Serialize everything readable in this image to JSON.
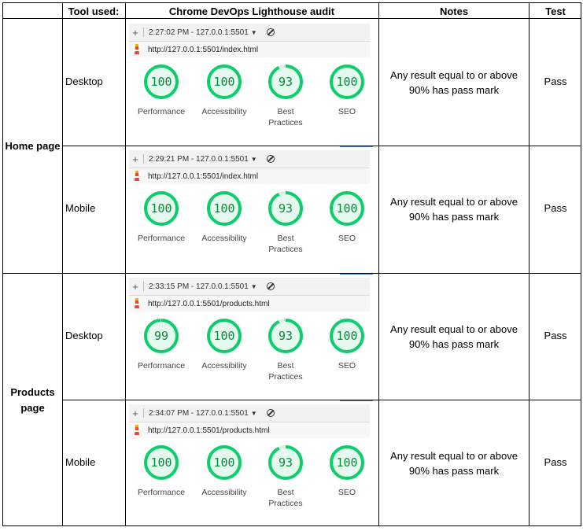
{
  "headers": {
    "tool_used": "Tool used:",
    "audit": "Chrome DevOps Lighthouse audit",
    "notes": "Notes",
    "test": "Test"
  },
  "groups": [
    {
      "label_lines": [
        "Home page"
      ],
      "rows": [
        {
          "device": "Desktop",
          "time": "2:27:02 PM - 127.0.0.1:5501",
          "url": "http://127.0.0.1:5501/index.html",
          "scores": [
            {
              "value": "100",
              "label_lines": [
                "Performance"
              ],
              "fraction": 1.0
            },
            {
              "value": "100",
              "label_lines": [
                "Accessibility"
              ],
              "fraction": 1.0
            },
            {
              "value": "93",
              "label_lines": [
                "Best",
                "Practices"
              ],
              "fraction": 0.93
            },
            {
              "value": "100",
              "label_lines": [
                "SEO"
              ],
              "fraction": 1.0
            }
          ],
          "note": "Any result equal to or above 90% has pass mark",
          "result": "Pass"
        },
        {
          "device": "Mobile",
          "time": "2:29:21 PM - 127.0.0.1:5501",
          "url": "http://127.0.0.1:5501/index.html",
          "scores": [
            {
              "value": "100",
              "label_lines": [
                "Performance"
              ],
              "fraction": 1.0
            },
            {
              "value": "100",
              "label_lines": [
                "Accessibility"
              ],
              "fraction": 1.0
            },
            {
              "value": "93",
              "label_lines": [
                "Best",
                "Practices"
              ],
              "fraction": 0.93
            },
            {
              "value": "100",
              "label_lines": [
                "SEO"
              ],
              "fraction": 1.0
            }
          ],
          "note": "Any result equal to or above 90% has pass mark",
          "result": "Pass"
        }
      ]
    },
    {
      "label_lines": [
        "Products",
        "page"
      ],
      "rows": [
        {
          "device": "Desktop",
          "time": "2:33:15 PM - 127.0.0.1:5501",
          "url": "http://127.0.0.1:5501/products.html",
          "scores": [
            {
              "value": "99",
              "label_lines": [
                "Performance"
              ],
              "fraction": 0.99
            },
            {
              "value": "100",
              "label_lines": [
                "Accessibility"
              ],
              "fraction": 1.0
            },
            {
              "value": "93",
              "label_lines": [
                "Best",
                "Practices"
              ],
              "fraction": 0.93
            },
            {
              "value": "100",
              "label_lines": [
                "SEO"
              ],
              "fraction": 1.0
            }
          ],
          "note": "Any result equal to or above 90% has pass mark",
          "result": "Pass"
        },
        {
          "device": "Mobile",
          "time": "2:34:07 PM - 127.0.0.1:5501",
          "url": "http://127.0.0.1:5501/products.html",
          "scores": [
            {
              "value": "100",
              "label_lines": [
                "Performance"
              ],
              "fraction": 1.0
            },
            {
              "value": "100",
              "label_lines": [
                "Accessibility"
              ],
              "fraction": 1.0
            },
            {
              "value": "93",
              "label_lines": [
                "Best",
                "Practices"
              ],
              "fraction": 0.93
            },
            {
              "value": "100",
              "label_lines": [
                "SEO"
              ],
              "fraction": 1.0
            }
          ],
          "note": "Any result equal to or above 90% has pass mark",
          "result": "Pass"
        }
      ]
    }
  ],
  "icons": {
    "plus": "plus-icon",
    "caret": "chevron-down-icon",
    "block": "block-icon",
    "lighthouse": "lighthouse-icon"
  },
  "colors": {
    "gauge_stroke": "#0cce6b",
    "gauge_fill": "#e6f9ef",
    "gauge_text": "#0a8a3a",
    "grid": "#000000",
    "accent": "#4a7fd8"
  }
}
